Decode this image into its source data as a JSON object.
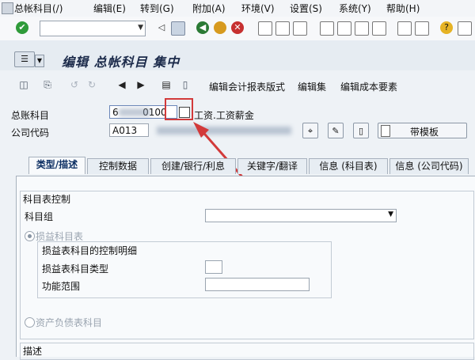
{
  "menubar": {
    "items": [
      "总帐科目(/)",
      "编辑(E)",
      "转到(G)",
      "附加(A)",
      "环境(V)",
      "设置(S)",
      "系统(Y)",
      "帮助(H)"
    ]
  },
  "toolbar": {
    "command_value": ""
  },
  "title": {
    "text": "编辑 总帐科目 集中"
  },
  "apptoolbar": {
    "btn1": "编辑会计报表版式",
    "btn2": "编辑集",
    "btn3": "编辑成本要素"
  },
  "header": {
    "gl_account_label": "总账科目",
    "gl_account_value": "6        0100",
    "gl_account_desc": "工资.工资薪金",
    "company_code_label": "公司代码",
    "company_code_value": "A013",
    "template_button": "带模板"
  },
  "tabs": [
    "类型/描述",
    "控制数据",
    "创建/银行/利息",
    "关键字/翻译",
    "信息 (科目表)",
    "信息 (公司代码)"
  ],
  "content": {
    "section_title": "科目表控制",
    "account_group_label": "科目组",
    "pl_account_radio": "损益科目表",
    "pl_group_title": "损益表科目的控制明细",
    "pl_type_label": "损益表科目类型",
    "functional_area_label": "功能范围",
    "bs_account_radio": "资产负债表科目",
    "description_title": "描述"
  }
}
